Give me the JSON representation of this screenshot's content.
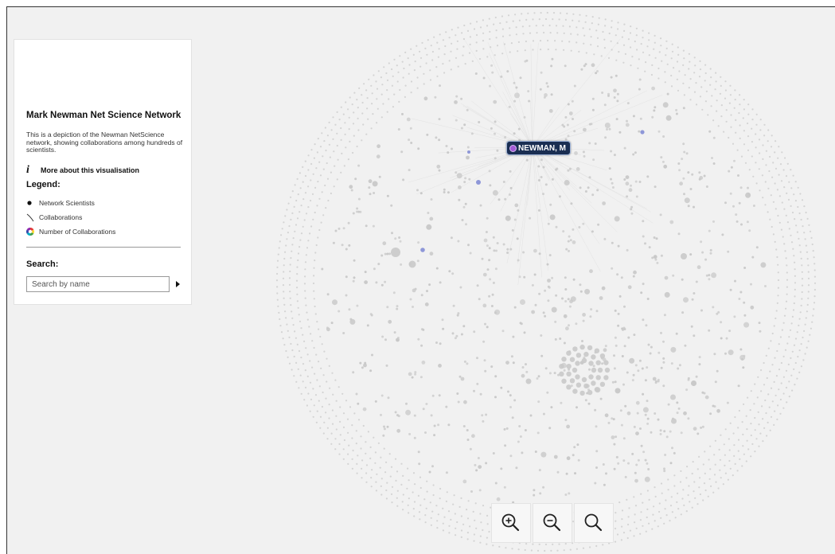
{
  "panel": {
    "title": "Mark Newman Net Science Network",
    "description": "This is a depiction of the Newman NetScience network, showing collaborations among hundreds of scientists.",
    "more_label": "More about this visualisation",
    "legend_title": "Legend:",
    "legend": [
      {
        "icon": "dot-icon",
        "label": "Network Scientists"
      },
      {
        "icon": "edge-line-icon",
        "label": "Collaborations"
      },
      {
        "icon": "color-wheel-icon",
        "label": "Number of Collaborations"
      }
    ],
    "search_title": "Search:",
    "search_placeholder": "Search by name"
  },
  "graph": {
    "highlighted_node": "NEWMAN, M",
    "node_color": "#c9c9c9",
    "highlight_color": "#8e97d8",
    "label_bg": "#1a2e52"
  },
  "zoom": {
    "buttons": [
      {
        "icon": "zoom-in-icon"
      },
      {
        "icon": "zoom-out-icon"
      },
      {
        "icon": "zoom-reset-icon"
      }
    ]
  }
}
